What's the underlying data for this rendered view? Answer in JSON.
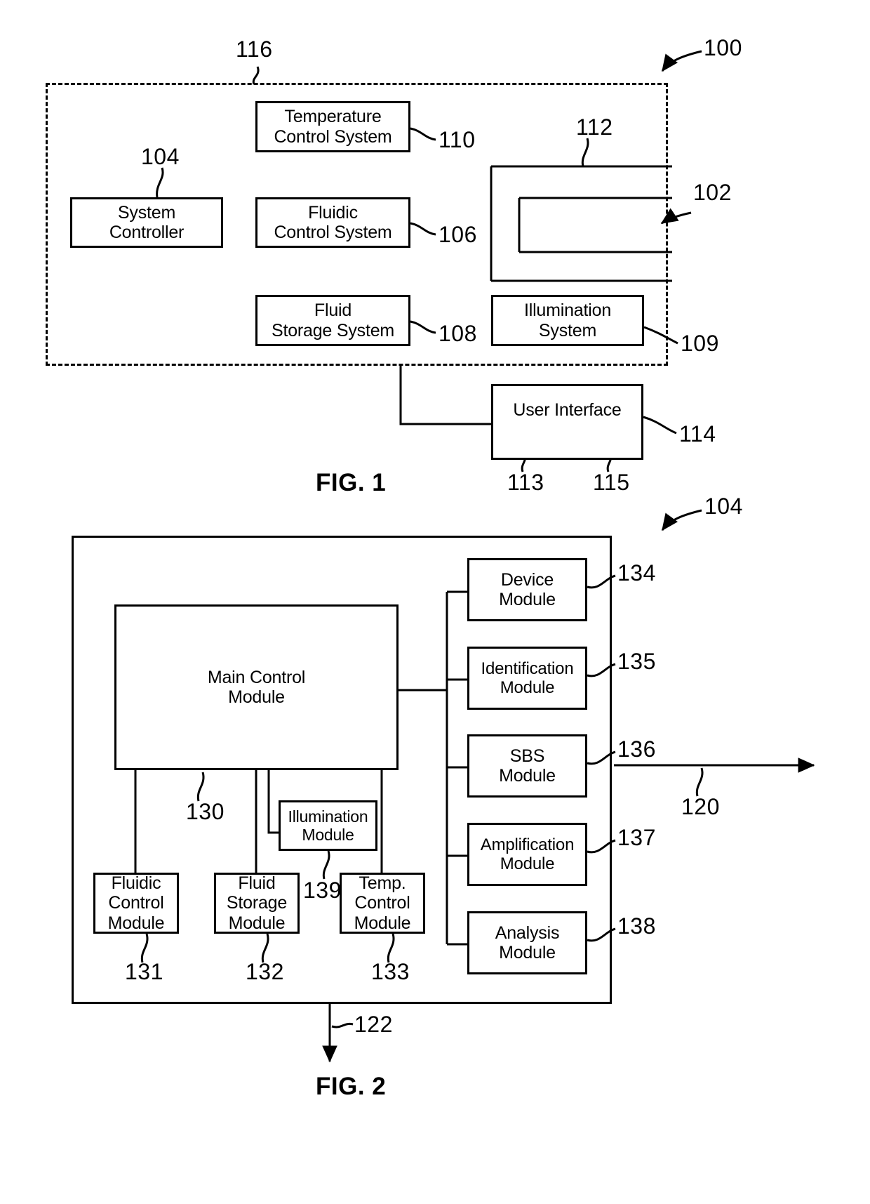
{
  "figure1": {
    "caption": "FIG. 1",
    "boundary_ref": "116",
    "system_ref": "100",
    "detector_ref": "102",
    "nodes": {
      "system_controller": "System\nController",
      "temperature_control_system": "Temperature\nControl System",
      "fluidic_control_system": "Fluidic\nControl System",
      "fluid_storage_system": "Fluid\nStorage System",
      "illumination_system": "Illumination\nSystem",
      "user_interface": "User Interface"
    },
    "refs": {
      "system_controller": "104",
      "temperature_control_system": "110",
      "fluidic_control_system": "106",
      "fluid_storage_system": "108",
      "illumination_system": "109",
      "flowcell_outer": "112",
      "flowcell_detector": "102",
      "user_interface": "114",
      "ui_left_region": "113",
      "ui_right_region": "115",
      "enclosure": "116",
      "system": "100"
    }
  },
  "figure2": {
    "caption": "FIG. 2",
    "controller_ref": "104",
    "nodes": {
      "main_control_module": "Main Control\nModule",
      "illumination_module": "Illumination\nModule",
      "fluidic_control_module": "Fluidic\nControl\nModule",
      "fluid_storage_module": "Fluid\nStorage\nModule",
      "temp_control_module": "Temp.\nControl\nModule",
      "device_module": "Device\nModule",
      "identification_module": "Identification\nModule",
      "sbs_module": "SBS\nModule",
      "amplification_module": "Amplification\nModule",
      "analysis_module": "Analysis\nModule"
    },
    "refs": {
      "controller": "104",
      "main_control_module": "130",
      "fluidic_control_module": "131",
      "fluid_storage_module": "132",
      "temp_control_module": "133",
      "device_module": "134",
      "identification_module": "135",
      "sbs_module": "136",
      "amplification_module": "137",
      "analysis_module": "138",
      "illumination_module": "139",
      "output_right": "120",
      "output_bottom": "122"
    }
  },
  "colors": {
    "line": "#000000",
    "background": "#ffffff"
  }
}
